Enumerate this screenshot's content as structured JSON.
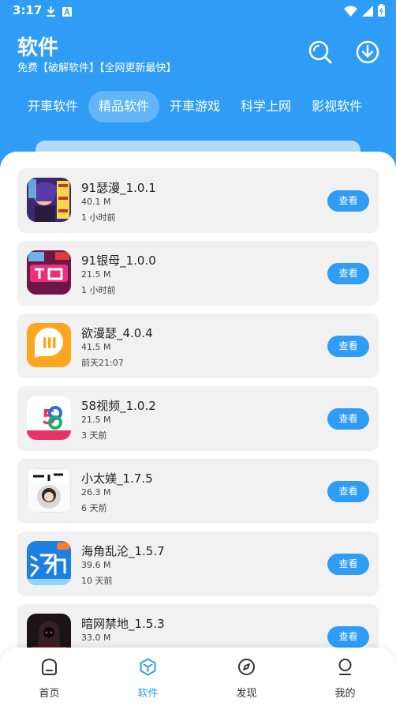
{
  "status_bar": {
    "time": "3:17"
  },
  "header": {
    "title": "软件",
    "subtitle": "免费【破解软件】【全网更新最快】",
    "search_icon": "search-icon",
    "download_icon": "download-icon"
  },
  "colors": {
    "primary": "#2f9df5",
    "card_bg": "#f1f1f1"
  },
  "tabs": [
    {
      "label": "开車软件",
      "active": false
    },
    {
      "label": "精品软件",
      "active": true
    },
    {
      "label": "开車游戏",
      "active": false
    },
    {
      "label": "科学上网",
      "active": false
    },
    {
      "label": "影视软件",
      "active": false
    }
  ],
  "apps": [
    {
      "name": "91瑟漫_1.0.1",
      "size": "40.1 M",
      "time": "1 小时前",
      "button": "查看"
    },
    {
      "name": "91银母_1.0.0",
      "size": "21.5 M",
      "time": "1 小时前",
      "button": "查看"
    },
    {
      "name": "欲漫瑟_4.0.4",
      "size": "41.5 M",
      "time": "前天21:07",
      "button": "查看"
    },
    {
      "name": "58视频_1.0.2",
      "size": "21.5 M",
      "time": "3 天前",
      "button": "查看"
    },
    {
      "name": "小太媄_1.7.5",
      "size": "26.3 M",
      "time": "6 天前",
      "button": "查看"
    },
    {
      "name": "海角乱沦_1.5.7",
      "size": "39.6 M",
      "time": "10 天前",
      "button": "查看"
    },
    {
      "name": "暗网禁地_1.5.3",
      "size": "33.0 M",
      "time": "",
      "button": "查看"
    }
  ],
  "bottom_nav": [
    {
      "label": "首页",
      "icon": "home-icon",
      "active": false
    },
    {
      "label": "软件",
      "icon": "box-icon",
      "active": true
    },
    {
      "label": "发现",
      "icon": "compass-icon",
      "active": false
    },
    {
      "label": "我的",
      "icon": "profile-icon",
      "active": false
    }
  ]
}
